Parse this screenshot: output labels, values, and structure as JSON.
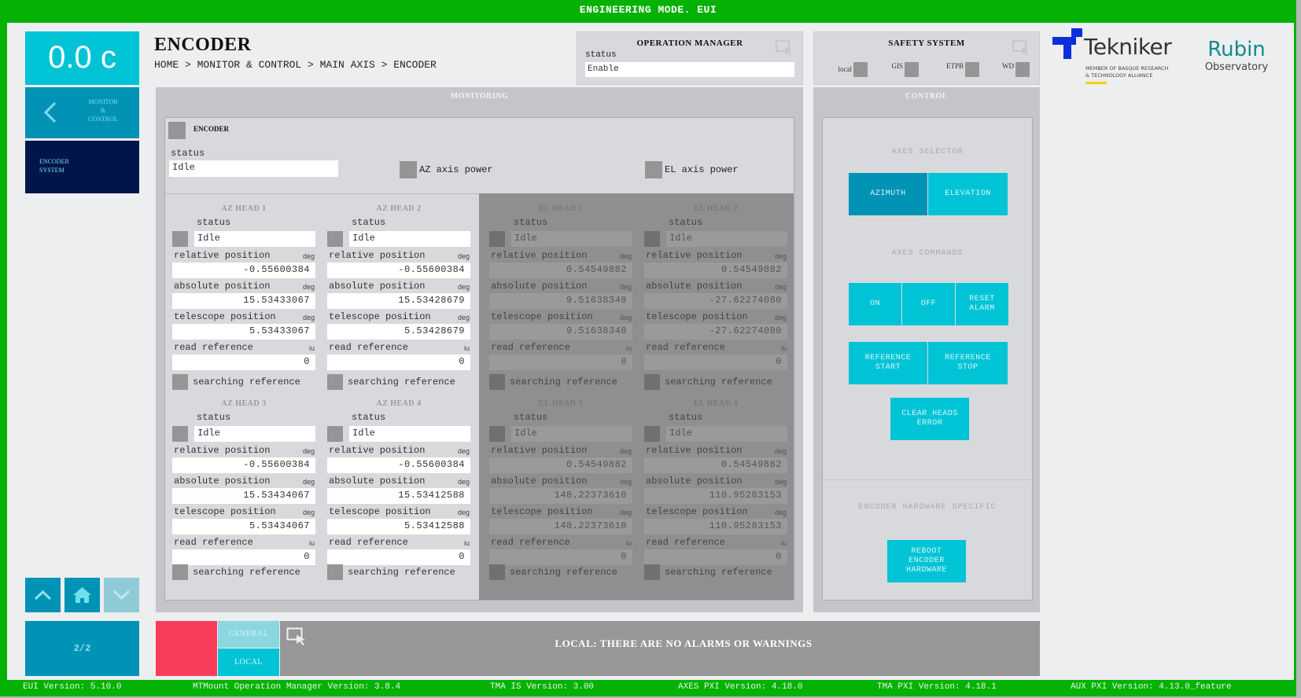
{
  "window": {
    "title": "ENGINEERING MODE. EUI"
  },
  "sidebar": {
    "temperature": "0.0 c",
    "back": {
      "label_lines": [
        "MONITOR",
        "&",
        "CONTROL"
      ]
    },
    "current": {
      "label_lines": [
        "ENCODER",
        "SYSTEM"
      ]
    },
    "nav": {
      "up": "chevron-up",
      "home": "home",
      "down": "chevron-down"
    },
    "page": "2/2"
  },
  "header": {
    "title": "ENCODER",
    "breadcrumb": "HOME > MONITOR & CONTROL > MAIN AXIS > ENCODER"
  },
  "operation_manager": {
    "title": "OPERATION MANAGER",
    "status_label": "status",
    "status_value": "Enable"
  },
  "safety_system": {
    "title": "SAFETY SYSTEM",
    "items": [
      "local",
      "GIS",
      "ETPB",
      "WD"
    ]
  },
  "logos": {
    "tekniker": {
      "name": "Tekniker",
      "sub_lines": [
        "MEMBER OF BASQUE RESEARCH",
        "& TECHNOLOGY ALLIANCE"
      ]
    },
    "rubin": {
      "name": "Rubin",
      "sub": "Observatory"
    }
  },
  "monitoring": {
    "title": "MONITORING",
    "encoder": {
      "title": "ENCODER",
      "status_label": "status",
      "status_value": "Idle",
      "az_axis_power": "AZ axis power",
      "el_axis_power": "EL axis power"
    },
    "field_labels": {
      "status": "status",
      "relative_position": "relative position",
      "absolute_position": "absolute position",
      "telescope_position": "telescope position",
      "read_reference": "read reference",
      "searching_reference": "searching reference"
    },
    "units": {
      "deg": "deg",
      "iu": "iu"
    },
    "heads": [
      {
        "title": "AZ HEAD 1",
        "status": "Idle",
        "relative_position": "-0.55600384",
        "absolute_position": "15.53433067",
        "telescope_position": "5.53433067",
        "read_reference": "0",
        "enabled": true
      },
      {
        "title": "AZ HEAD 2",
        "status": "Idle",
        "relative_position": "-0.55600384",
        "absolute_position": "15.53428679",
        "telescope_position": "5.53428679",
        "read_reference": "0",
        "enabled": true
      },
      {
        "title": "EL HEAD 1",
        "status": "Idle",
        "relative_position": "0.54549882",
        "absolute_position": "9.51638348",
        "telescope_position": "9.51638348",
        "read_reference": "0",
        "enabled": false
      },
      {
        "title": "EL HEAD 2",
        "status": "Idle",
        "relative_position": "0.54549882",
        "absolute_position": "-27.62274080",
        "telescope_position": "-27.62274080",
        "read_reference": "0",
        "enabled": false
      },
      {
        "title": "AZ HEAD 3",
        "status": "Idle",
        "relative_position": "-0.55600384",
        "absolute_position": "15.53434067",
        "telescope_position": "5.53434067",
        "read_reference": "0",
        "enabled": true
      },
      {
        "title": "AZ HEAD 4",
        "status": "Idle",
        "relative_position": "-0.55600384",
        "absolute_position": "15.53412588",
        "telescope_position": "5.53412588",
        "read_reference": "0",
        "enabled": true
      },
      {
        "title": "EL HEAD 3",
        "status": "Idle",
        "relative_position": "0.54549882",
        "absolute_position": "148.22373610",
        "telescope_position": "148.22373610",
        "read_reference": "0",
        "enabled": false
      },
      {
        "title": "EL HEAD 4",
        "status": "Idle",
        "relative_position": "0.54549882",
        "absolute_position": "110.95283153",
        "telescope_position": "110.95283153",
        "read_reference": "0",
        "enabled": false
      }
    ]
  },
  "control": {
    "title": "CONTROL",
    "axes_selector": {
      "label": "AXES SELECTOR",
      "azimuth": "AZIMUTH",
      "elevation": "ELEVATION",
      "selected": "AZIMUTH"
    },
    "axes_commands": {
      "label": "AXES COMMANDS",
      "on": "ON",
      "off": "OFF",
      "reset_alarm": [
        "RESET",
        "ALARM"
      ],
      "reference_start": [
        "REFERENCE",
        "START"
      ],
      "reference_stop": [
        "REFERENCE",
        "STOP"
      ],
      "clear_heads_error": [
        "CLEAR HEADS",
        "ERROR"
      ]
    },
    "hardware": {
      "label": "ENCODER HARDWARE SPECIFIC",
      "reboot": [
        "REBOOT",
        "ENCODER",
        "HARDWARE"
      ]
    }
  },
  "alarms": {
    "tab_general": "GENERAL",
    "tab_local": "LOCAL",
    "active_tab": "LOCAL",
    "message": "LOCAL: THERE ARE NO ALARMS OR WARNINGS",
    "status_color": "#f83c5a"
  },
  "footer": {
    "eui_version": "EUI Version: 5.10.0",
    "opm_version": "MTMount Operation Manager Version: 3.8.4",
    "tma_is_version": "TMA IS Version: 3.00",
    "axes_pxi_version": "AXES PXI Version: 4.18.0",
    "tma_pxi_version": "TMA PXI Version: 4.18.1",
    "aux_pxi_version": "AUX PXI Version: 4.13.0_feature"
  },
  "colors": {
    "frame_green": "#04b104",
    "accent_cyan": "#00c4d6",
    "accent_blue": "#0093b6",
    "navy": "#00164a",
    "alarm_red": "#f83c5a"
  }
}
